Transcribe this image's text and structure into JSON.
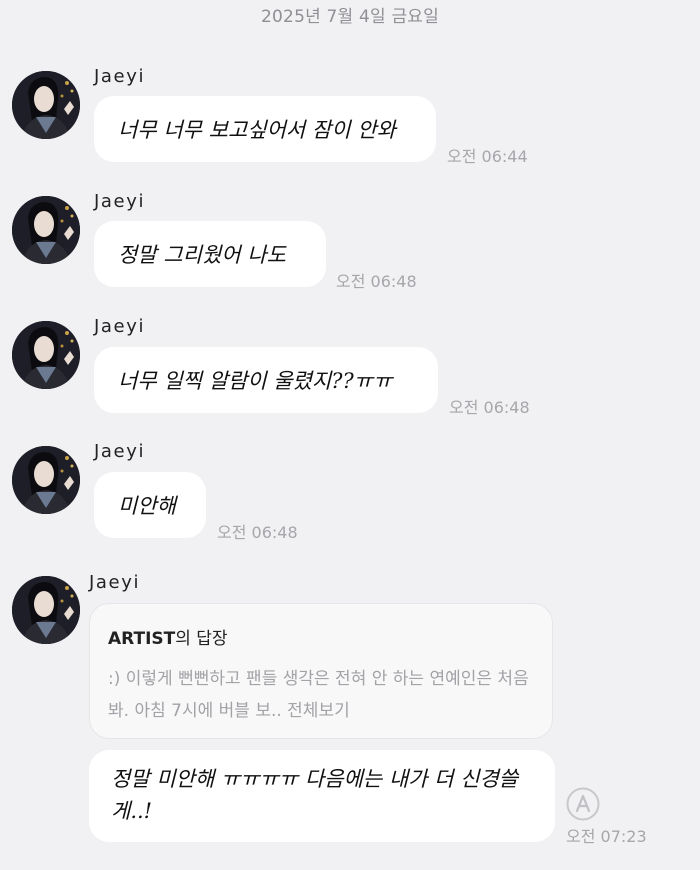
{
  "date_header": "2025년 7월 4일 금요일",
  "messages": [
    {
      "sender": "Jaeyi",
      "text": "너무 너무 보고싶어서 잠이 안와",
      "time": "오전 06:44"
    },
    {
      "sender": "Jaeyi",
      "text": "정말 그리웠어 나도",
      "time": "오전 06:48"
    },
    {
      "sender": "Jaeyi",
      "text": "너무 일찍 알람이 울렸지??ㅠㅠ",
      "time": "오전 06:48"
    },
    {
      "sender": "Jaeyi",
      "text": "미안해",
      "time": "오전 06:48"
    }
  ],
  "reply_message": {
    "sender": "Jaeyi",
    "quote_author": "ARTIST",
    "quote_suffix": "의 답장",
    "quote_text": ":) 이렇게 뻔뻔하고 팬들 생각은 전혀 안 하는 연예인은 처음 봐. 아침 7시에 버블 보.. 전체보기",
    "text": "정말 미안해 ㅠㅠㅠㅠ 다음에는 내가 더 신경쓸게..!",
    "time": "오전 07:23"
  },
  "icons": {
    "avatar": "profile-photo",
    "translate": "translate-icon"
  },
  "colors": {
    "background": "#f1f1f3",
    "bubble": "#ffffff",
    "timestamp": "#a6a6ab"
  }
}
